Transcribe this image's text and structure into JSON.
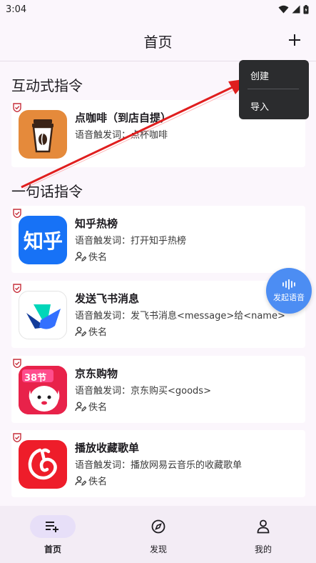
{
  "status_bar": {
    "time": "3:04",
    "icons": [
      "wifi-icon",
      "signal-icon",
      "battery-icon"
    ]
  },
  "app_bar": {
    "title": "首页",
    "action_icon": "plus-icon"
  },
  "dropdown_menu": {
    "items": [
      "创建",
      "导入"
    ]
  },
  "sections": {
    "interactive": {
      "title": "互动式指令",
      "cards": [
        {
          "title": "点咖啡（到店自提）",
          "trigger": "语音触发词：点杯咖啡",
          "icon": "coffee-cup-icon"
        }
      ]
    },
    "one_sentence": {
      "title": "一句话指令",
      "cards": [
        {
          "title": "知乎热榜",
          "trigger": "语音触发词：打开知乎热榜",
          "author": "佚名",
          "icon": "zhihu-logo-icon",
          "icon_text": "知乎"
        },
        {
          "title": "发送飞书消息",
          "trigger": "语音触发词：发飞书消息<message>给<name>",
          "author": "佚名",
          "icon": "feishu-logo-icon"
        },
        {
          "title": "京东购物",
          "trigger": "语音触发词：京东购买<goods>",
          "author": "佚名",
          "icon": "jd-logo-icon",
          "icon_text": "38节"
        },
        {
          "title": "播放收藏歌单",
          "trigger": "语音触发词：播放网易云音乐的收藏歌单",
          "author": "佚名",
          "icon": "netease-music-logo-icon"
        }
      ]
    }
  },
  "voice_button": {
    "label": "发起语音",
    "icon": "voice-wave-icon"
  },
  "bottom_nav": {
    "items": [
      {
        "label": "首页",
        "icon": "playlist-add-icon",
        "active": true
      },
      {
        "label": "发现",
        "icon": "compass-icon",
        "active": false
      },
      {
        "label": "我的",
        "icon": "person-icon",
        "active": false
      }
    ]
  },
  "colors": {
    "background": "#fbf6fc",
    "card": "#ffffff",
    "accent_pill": "#e7dff8",
    "voice_button": "#4c8df3",
    "badge_red": "#c62e3a",
    "annotation_arrow": "#e01e1e",
    "menu_bg": "#2b2c2e"
  }
}
